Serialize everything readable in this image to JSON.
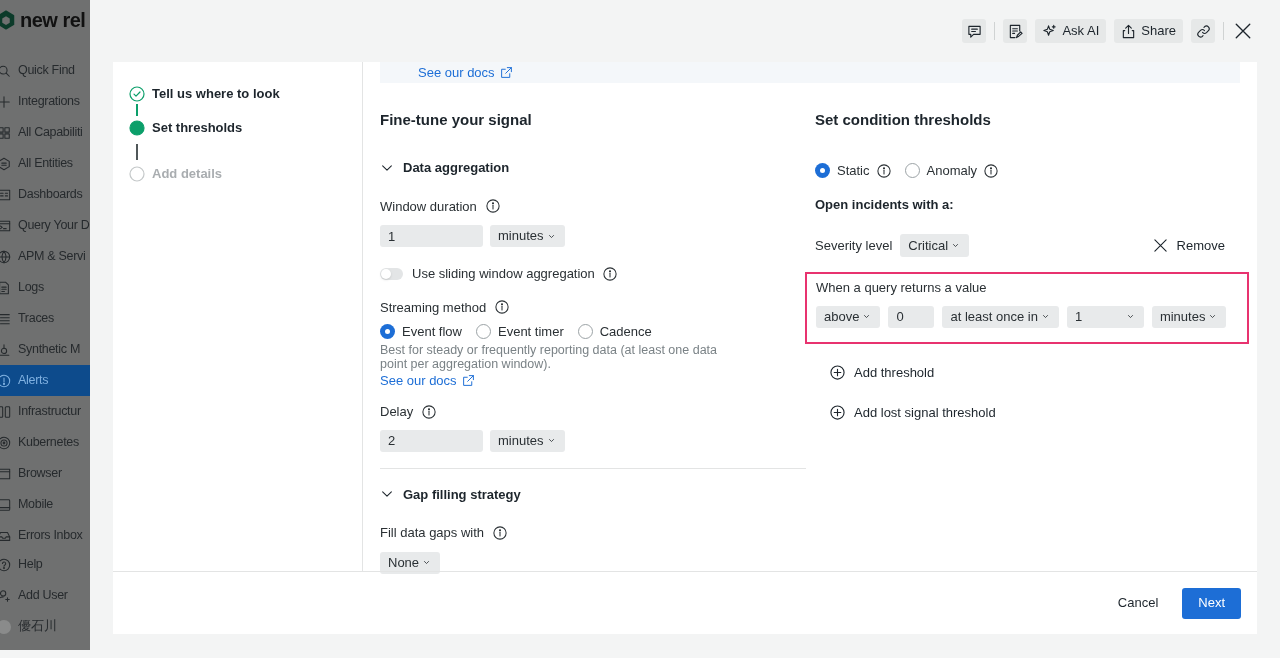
{
  "sidebar": {
    "logo": "new rel",
    "items": [
      {
        "label": "Quick Find",
        "selected": false
      },
      {
        "label": "Integrations",
        "selected": false
      },
      {
        "label": "All Capabiliti",
        "selected": false
      },
      {
        "label": "All Entities",
        "selected": false
      },
      {
        "label": "Dashboards",
        "selected": false
      },
      {
        "label": "Query Your D",
        "selected": false
      },
      {
        "label": "APM & Servi",
        "selected": false
      },
      {
        "label": "Logs",
        "selected": false
      },
      {
        "label": "Traces",
        "selected": false
      },
      {
        "label": "Synthetic M",
        "selected": false
      },
      {
        "label": "Alerts",
        "selected": true
      },
      {
        "label": "Infrastructur",
        "selected": false
      },
      {
        "label": "Kubernetes",
        "selected": false
      },
      {
        "label": "Browser",
        "selected": false
      },
      {
        "label": "Mobile",
        "selected": false
      },
      {
        "label": "Errors Inbox",
        "selected": false
      },
      {
        "label": "Help",
        "selected": false
      },
      {
        "label": "Add User",
        "selected": false
      }
    ],
    "user": "優石川"
  },
  "toolbar": {
    "ask_ai": "Ask AI",
    "share": "Share"
  },
  "steps": [
    {
      "label": "Tell us where to look",
      "checked": true,
      "selected": false
    },
    {
      "label": "Set thresholds",
      "checked": false,
      "selected": true
    },
    {
      "label": "Add details",
      "checked": false,
      "selected": false
    }
  ],
  "banner": {
    "link": "See our docs"
  },
  "signal": {
    "title": "Fine-tune your signal",
    "aggregation": {
      "title": "Data aggregation",
      "expanded": true,
      "window_duration": {
        "label": "Window duration",
        "value": "1",
        "unit": "minutes"
      },
      "sliding": {
        "label": "Use sliding window aggregation",
        "on": false
      },
      "streaming": {
        "label": "Streaming method",
        "options": [
          {
            "label": "Event flow",
            "selected": true
          },
          {
            "label": "Event timer",
            "selected": false
          },
          {
            "label": "Cadence",
            "selected": false
          }
        ],
        "help": "Best for steady or frequently reporting data (at least one data point per aggregation window).",
        "link": "See our docs"
      },
      "delay": {
        "label": "Delay",
        "value": "2",
        "unit": "minutes"
      }
    },
    "gap_filling": {
      "title": "Gap filling strategy",
      "expanded": true,
      "fill": {
        "label": "Fill data gaps with",
        "value": "None"
      }
    }
  },
  "thresholds": {
    "title": "Set condition thresholds",
    "types": [
      {
        "label": "Static",
        "selected": true
      },
      {
        "label": "Anomaly",
        "selected": false
      }
    ],
    "open_label": "Open incidents with a:",
    "severity": {
      "label": "Severity level",
      "value": "Critical"
    },
    "remove": "Remove",
    "condition": {
      "label": "When a query returns a value",
      "operator": "above",
      "value": "0",
      "occurrence": "at least once in",
      "duration": "1",
      "unit": "minutes",
      "highlighted": true
    },
    "actions": [
      "Add threshold",
      "Add lost signal threshold"
    ]
  },
  "footer": {
    "cancel": "Cancel",
    "next": "Next"
  }
}
